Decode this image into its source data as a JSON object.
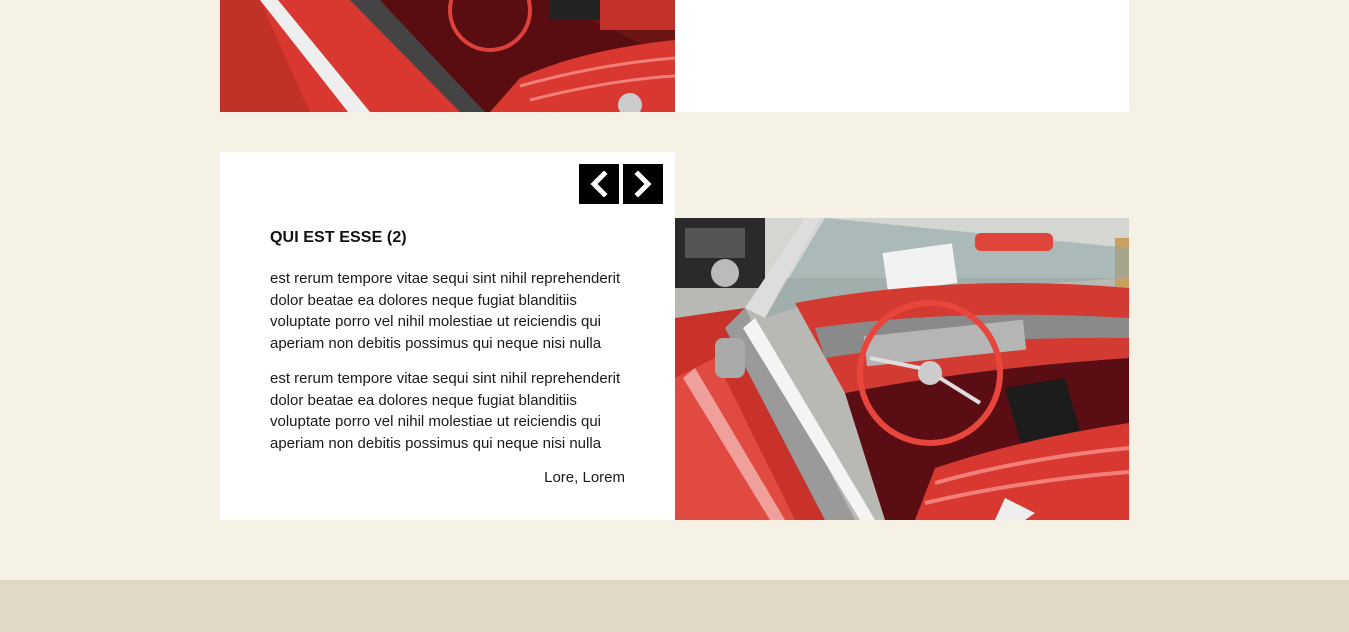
{
  "top_card": {
    "image": "red-convertible-car-interior-photo"
  },
  "card": {
    "title": "QUI EST ESSE (2)",
    "paragraphs": [
      "est rerum tempore vitae sequi sint nihil reprehenderit dolor beatae ea dolores neque fugiat blanditiis voluptate porro vel nihil molestiae ut reiciendis qui aperiam non debitis possimus qui neque nisi nulla",
      "est rerum tempore vitae sequi sint nihil reprehenderit dolor beatae ea dolores neque fugiat blanditiis voluptate porro vel nihil molestiae ut reiciendis qui aperiam non debitis possimus qui neque nisi nulla"
    ],
    "author": "Lore, Lorem",
    "image": "red-convertible-car-interior-photo",
    "nav": {
      "prev_icon": "chevron-left-icon",
      "next_icon": "chevron-right-icon"
    }
  },
  "colors": {
    "page_background": "#f5f1e4",
    "footer_background": "#e0d9c6",
    "card_background": "#ffffff",
    "nav_button": "#000000",
    "car_red": "#d8382f"
  }
}
